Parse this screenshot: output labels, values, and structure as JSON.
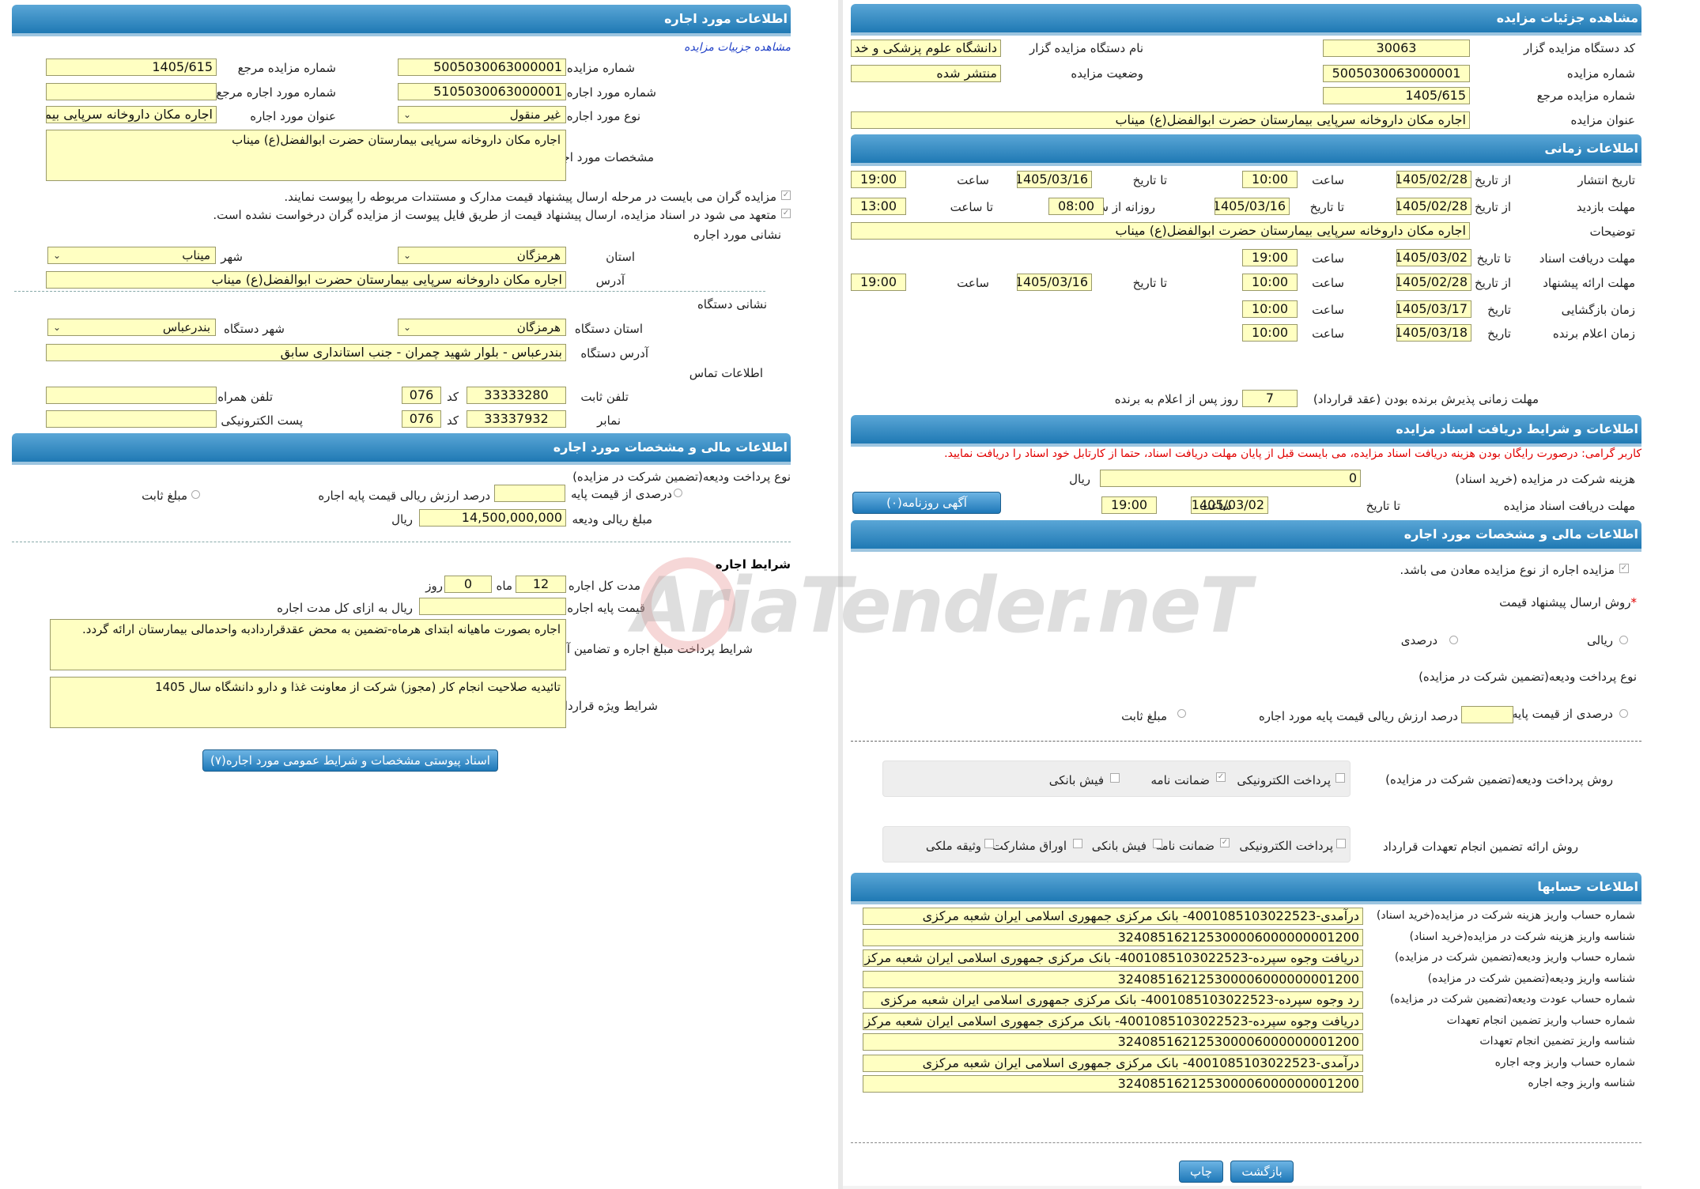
{
  "watermark": "AriaTender.neT",
  "right": {
    "h1": "مشاهده جزئیات مزایده",
    "code_lbl": "کد دستگاه مزایده گزار",
    "code_val": "30063",
    "org_lbl": "نام دستگاه مزایده گزار",
    "org_val": "دانشگاه علوم پزشکی و خد",
    "num_lbl": "شماره مزایده",
    "num_val": "5005030063000001",
    "status_lbl": "وضعیت مزایده",
    "status_val": "منتشر شده",
    "ref_lbl": "شماره مزایده مرجع",
    "ref_val": "1405/615",
    "title_lbl": "عنوان مزایده",
    "title_val": "اجاره  مکان داروخانه سرپایی بیمارستان حضرت ابوالفضل(ع) میناب",
    "h2": "اطلاعات زمانی",
    "pub_lbl": "تاریخ انتشار",
    "from_date": "از تاریخ",
    "to_date": "تا تاریخ",
    "time_lbl": "ساعت",
    "pub_from": "1405/02/28",
    "pub_from_t": "10:00",
    "pub_to": "1405/03/16",
    "pub_to_t": "19:00",
    "visit_lbl": "مهلت بازدید",
    "visit_from": "1405/02/28",
    "visit_to": "1405/03/16",
    "daily_from": "روزانه از ساعت",
    "visit_t1": "08:00",
    "to_time": "تا ساعت",
    "visit_t2": "13:00",
    "desc_lbl": "توضیحات",
    "desc_val": "اجاره  مکان داروخانه سرپایی بیمارستان حضرت ابوالفضل(ع) میناب",
    "docs_lbl": "مهلت دریافت اسناد",
    "docs_to": "1405/03/02",
    "docs_t": "19:00",
    "offer_lbl": "مهلت ارائه پیشنهاد",
    "offer_from": "1405/02/28",
    "offer_from_t": "10:00",
    "offer_to": "1405/03/16",
    "offer_to_t": "19:00",
    "open_lbl": "زمان بازگشایی",
    "date_lbl": "تاریخ",
    "open_d": "1405/03/17",
    "open_t": "10:00",
    "win_lbl": "زمان اعلام برنده",
    "win_d": "1405/03/18",
    "win_t": "10:00",
    "accept_lbl": "مهلت زمانی پذیرش برنده بودن (عقد قرارداد)",
    "accept_val": "7",
    "accept_suffix": "روز پس از اعلام به برنده",
    "h3": "اطلاعات و شرایط دریافت اسناد مزایده",
    "notice": "کاربر گرامی: درصورت رایگان بودن هزینه دریافت اسناد مزایده، می بایست قبل از پایان مهلت دریافت اسناد، حتما از کارتابل خود اسناد را دریافت نمایید.",
    "fee_lbl": "هزینه شرکت در مزایده (خرید اسناد)",
    "fee_val": "0",
    "rial": "ریال",
    "recv_lbl": "مهلت دریافت اسناد مزایده",
    "recv_d": "1405/03/02",
    "recv_t": "19:00",
    "news_btn": "آگهی روزنامه(۰)",
    "h4": "اطلاعات مالی و مشخصات مورد اجاره",
    "mines": "مزایده اجاره از نوع مزایده معادن می باشد.",
    "method_lbl": "روش ارسال پیشنهاد قیمت",
    "rial_opt": "ریالی",
    "pct_opt": "درصدی",
    "deposit_type": "نوع پرداخت ودیعه(تضمین شرکت در مزایده)",
    "pct_base": "درصدی از قیمت پایه",
    "pct_base2": "درصد ارزش ریالی قیمت پایه مورد اجاره",
    "fixed": "مبلغ ثابت",
    "pay_lbl": "روش پرداخت ودیعه(تضمین شرکت در مزایده)",
    "g_elec": "پرداخت الکترونیکی",
    "g_guar": "ضمانت نامه",
    "g_bank": "فیش بانکی",
    "ret_lbl": "روش ارائه تضمین انجام تعهدات قرارداد",
    "g_bonds": "اوراق مشارکت",
    "g_prop": "وثیقه ملکی",
    "h5": "اطلاعات حسابها",
    "accounts": [
      {
        "l": "شماره حساب واریز هزینه شرکت در مزایده(خرید اسناد)",
        "v": "درآمدی-4001085103022523- بانک مرکزی جمهوری اسلامی ایران شعبه مرکزی"
      },
      {
        "l": "شناسه واریز هزینه شرکت در مزایده(خرید اسناد)",
        "v": "324085162125300006000000001200"
      },
      {
        "l": "شماره حساب واریز ودیعه(تضمین شرکت در مزایده)",
        "v": "دریافت وجوه سپرده-4001085103022523- بانک مرکزی جمهوری اسلامی ایران شعبه مرکزی"
      },
      {
        "l": "شناسه واریز ودیعه(تضمین شرکت در مزایده)",
        "v": "324085162125300006000000001200"
      },
      {
        "l": "شماره حساب عودت ودیعه(تضمین شرکت در مزایده)",
        "v": "رد وجوه سپرده-4001085103022523- بانک مرکزی جمهوری اسلامی ایران شعبه مرکزی"
      },
      {
        "l": "شماره حساب واریز تضمین انجام تعهدات",
        "v": "دریافت وجوه سپرده-4001085103022523- بانک مرکزی جمهوری اسلامی ایران شعبه مرکزی"
      },
      {
        "l": "شناسه واریز تضمین انجام تعهدات",
        "v": "324085162125300006000000001200"
      },
      {
        "l": "شماره حساب واریز وجه اجاره",
        "v": "درآمدی-4001085103022523- بانک مرکزی جمهوری اسلامی ایران شعبه مرکزی"
      },
      {
        "l": "شناسه واریز وجه اجاره",
        "v": "324085162125300006000000001200"
      }
    ],
    "print_btn": "چاپ",
    "back_btn": "بازگشت"
  },
  "left": {
    "h1": "اطلاعات مورد اجاره",
    "link": "مشاهده جزییات مزایده",
    "num_lbl": "شماره مزایده",
    "num_val": "5005030063000001",
    "ref_lbl": "شماره مزایده مرجع",
    "ref_val": "1405/615",
    "item_num_lbl": "شماره مورد اجاره",
    "item_num_val": "5105030063000001",
    "item_ref_lbl": "شماره مورد اجاره مرجع",
    "item_ref_val": "",
    "type_lbl": "نوع مورد اجاره",
    "type_val": "غیر منقول",
    "item_title_lbl": "عنوان مورد اجاره",
    "item_title_val": "اجاره  مکان داروخانه سرپایی بیمارستان حضرت ابوالفضل(ع) میناب",
    "spec_lbl": "مشخصات مورد اجاره",
    "spec_val": "اجاره  مکان داروخانه سرپایی بیمارستان حضرت ابوالفضل(ع) میناب",
    "chk1": "مزایده گران می بایست در مرحله ارسال پیشنهاد قیمت مدارک و مستندات مربوطه را پیوست نمایند.",
    "chk2": "متعهد می شود در اسناد مزایده، ارسال پیشنهاد قیمت از طریق فایل پیوست از مزایده گران درخواست نشده است.",
    "addr_title": "نشانی مورد اجاره",
    "prov_lbl": "استان",
    "prov_val": "هرمزگان",
    "city_lbl": "شهر",
    "city_val": "میناب",
    "addr_lbl": "آدرس",
    "addr_val": "اجاره مکان داروخانه سرپایی بیمارستان حضرت ابوالفضل(ع) میناب",
    "org_title": "نشانی دستگاه",
    "org_prov_lbl": "استان دستگاه",
    "org_prov_val": "هرمزگان",
    "org_city_lbl": "شهر دستگاه",
    "org_city_val": "بندرعباس",
    "org_addr_lbl": "آدرس دستگاه",
    "org_addr_val": "بندرعباس - بلوار شهید چمران - جنب استانداری سابق",
    "contact_title": "اطلاعات تماس",
    "phone_lbl": "تلفن ثابت",
    "phone_val": "33333280",
    "code_lbl": "کد",
    "code_val": "076",
    "mobile_lbl": "تلفن همراه",
    "mobile_val": "",
    "fax_lbl": "نمابر",
    "fax_val": "33337932",
    "fax_code": "076",
    "email_lbl": "پست الکترونیکی",
    "email_val": "",
    "h2": "اطلاعات مالی و مشخصات مورد اجاره",
    "deposit_type": "نوع پرداخت ودیعه(تضمین شرکت در مزایده)",
    "pct_base": "درصدی از قیمت پایه",
    "pct_base2": "درصد ارزش ریالی قیمت پایه اجاره",
    "fixed": "مبلغ ثابت",
    "deposit_lbl": "مبلغ ریالی ودیعه",
    "deposit_val": "14,500,000,000",
    "rial": "ریال",
    "terms_title": "شرایط اجاره",
    "dur_lbl": "مدت کل اجاره",
    "months": "12",
    "month_lbl": "ماه",
    "days": "0",
    "day_lbl": "روز",
    "base_lbl": "قیمت پایه اجاره",
    "base_suffix": "ریال به ازای کل مدت اجاره",
    "base_val": "",
    "payterms_lbl": "شرایط پرداخت مبلغ اجاره و تضامین آن",
    "payterms_val": "اجاره بصورت ماهیانه ابتدای هرماه-تضمین به محض عقدقراردادبه واحدمالی بیمارستان ارائه گردد.",
    "special_lbl": "شرایط ویژه قرارداد",
    "special_val": "تائیدیه صلاحیت انجام کار (مجوز) شرکت از معاونت غذا و دارو دانشگاه سال 1405",
    "docs_btn": "اسناد پیوستی مشخصات و شرایط عمومی مورد اجاره(۷)"
  }
}
